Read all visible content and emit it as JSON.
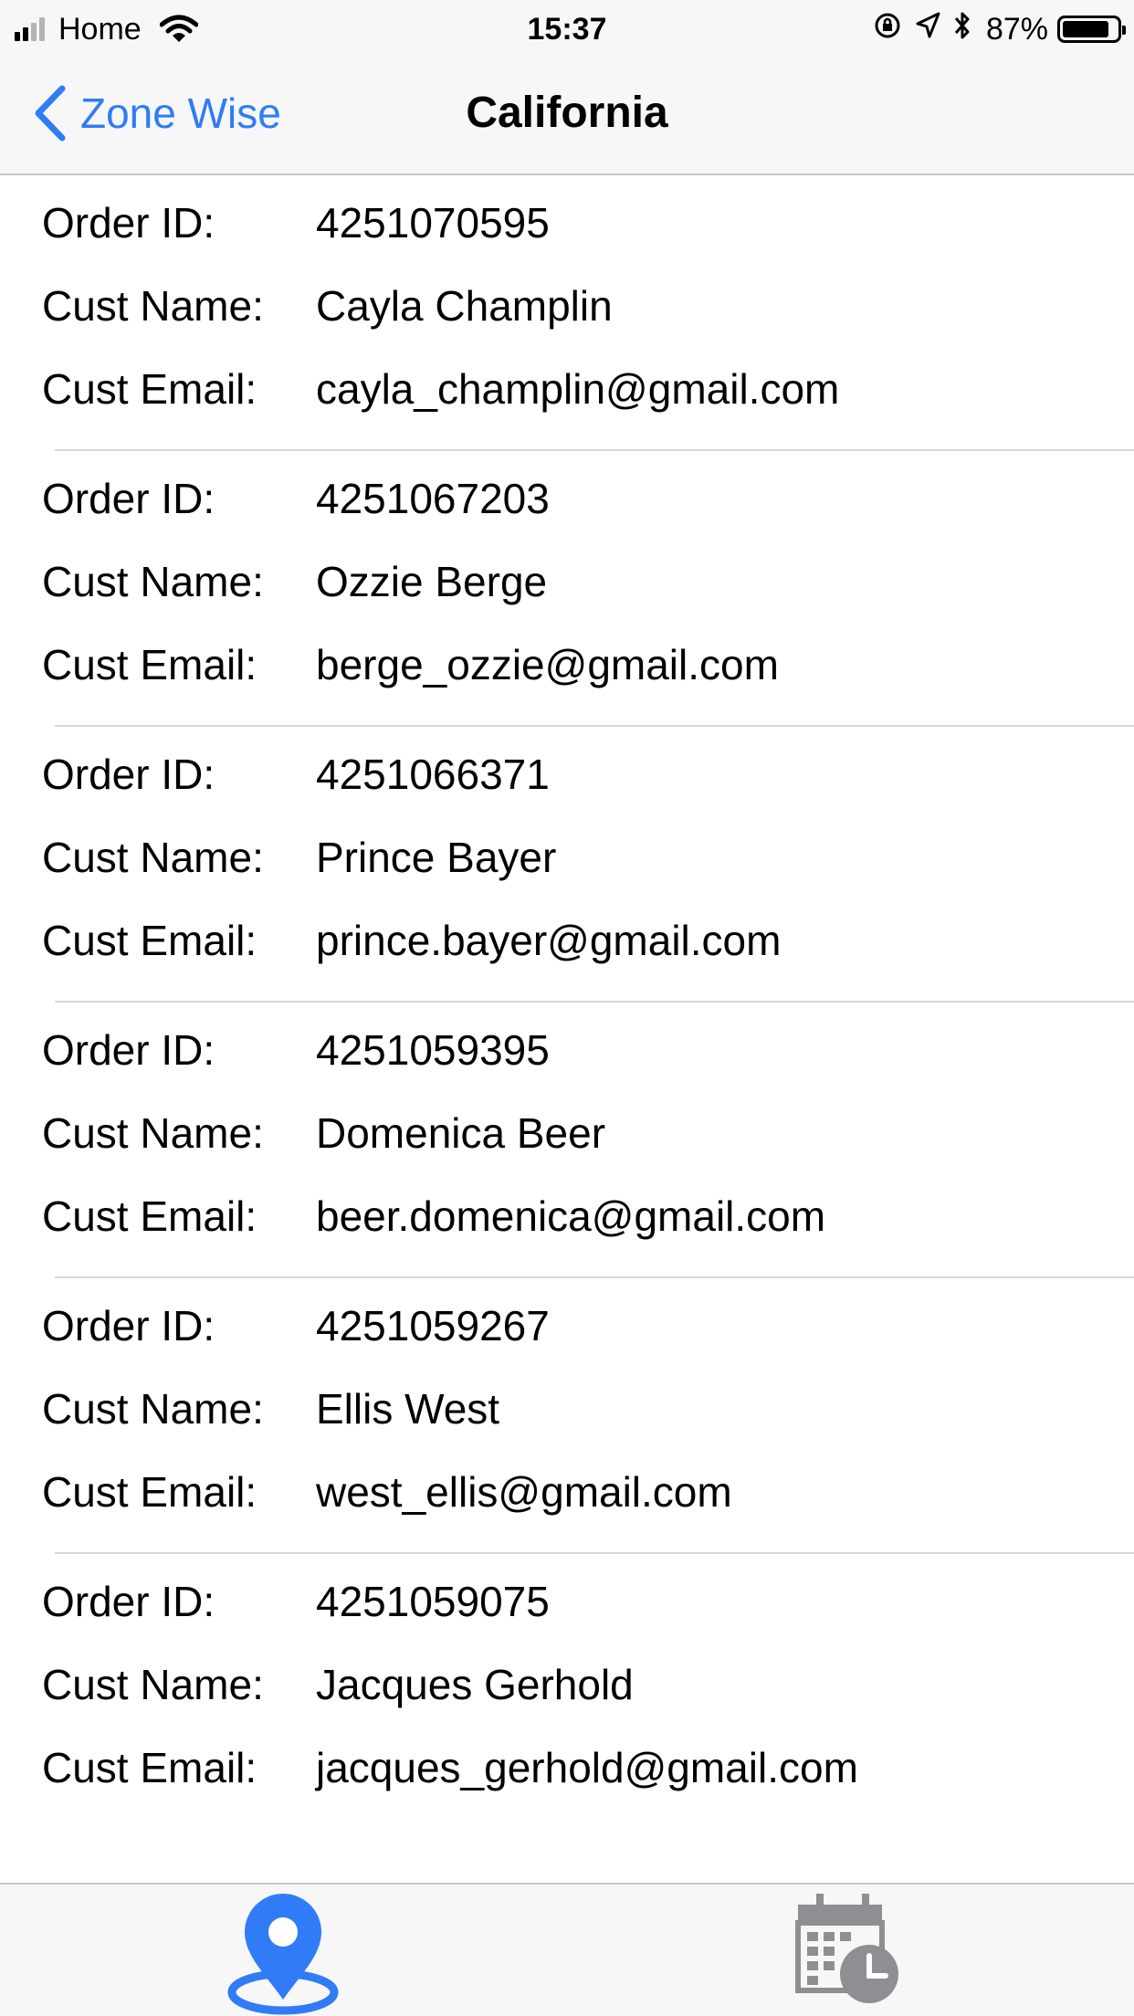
{
  "status_bar": {
    "carrier": "Home",
    "time": "15:37",
    "battery_percent": "87%",
    "battery_level": 0.87,
    "signal_bars_filled": 2,
    "signal_bars_total": 4
  },
  "nav": {
    "back_label": "Zone Wise",
    "title": "California"
  },
  "labels": {
    "order_id": "Order ID:",
    "cust_name": "Cust Name:",
    "cust_email": "Cust Email:"
  },
  "orders": [
    {
      "order_id": "4251070595",
      "name": "Cayla Champlin",
      "email": "cayla_champlin@gmail.com"
    },
    {
      "order_id": "4251067203",
      "name": "Ozzie Berge",
      "email": "berge_ozzie@gmail.com"
    },
    {
      "order_id": "4251066371",
      "name": "Prince Bayer",
      "email": "prince.bayer@gmail.com"
    },
    {
      "order_id": "4251059395",
      "name": "Domenica Beer",
      "email": "beer.domenica@gmail.com"
    },
    {
      "order_id": "4251059267",
      "name": "Ellis West",
      "email": "west_ellis@gmail.com"
    },
    {
      "order_id": "4251059075",
      "name": "Jacques Gerhold",
      "email": "jacques_gerhold@gmail.com"
    }
  ],
  "tabs": [
    {
      "icon": "map-pin-icon",
      "selected": true
    },
    {
      "icon": "calendar-clock-icon",
      "selected": false
    }
  ],
  "colors": {
    "accent": "#2f7cf6",
    "inactive_tab": "#8e8e93",
    "separator": "#d9d9dd",
    "bar_background": "#f7f7f7"
  }
}
